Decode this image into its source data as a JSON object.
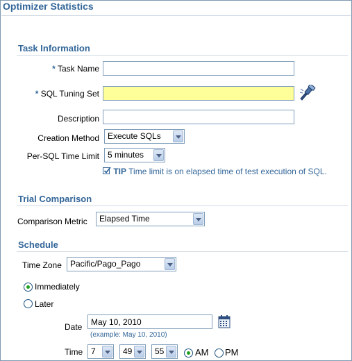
{
  "page": {
    "title": "Optimizer Statistics"
  },
  "task_information": {
    "header": "Task Information",
    "required_marker": "*",
    "task_name": {
      "label": "Task Name",
      "value": ""
    },
    "sql_tuning_set": {
      "label": "SQL Tuning Set",
      "value": "",
      "search_icon": "flashlight-search-icon"
    },
    "description": {
      "label": "Description",
      "value": ""
    },
    "creation_method": {
      "label": "Creation Method",
      "selected": "Execute SQLs"
    },
    "per_sql_time_limit": {
      "label": "Per-SQL Time Limit",
      "selected": "5 minutes"
    },
    "tip": {
      "prefix": "TIP",
      "text": "Time limit is on elapsed time of test execution of SQL."
    }
  },
  "trial_comparison": {
    "header": "Trial Comparison",
    "comparison_metric": {
      "label": "Comparison Metric",
      "selected": "Elapsed Time"
    }
  },
  "schedule": {
    "header": "Schedule",
    "time_zone": {
      "label": "Time Zone",
      "selected": "Pacific/Pago_Pago"
    },
    "immediately": {
      "label": "Immediately",
      "checked": true
    },
    "later": {
      "label": "Later",
      "checked": false
    },
    "date": {
      "label": "Date",
      "value": "May 10, 2010",
      "example": "(example: May 10, 2010)",
      "calendar_icon": "calendar-icon"
    },
    "time": {
      "label": "Time",
      "hour": "7",
      "minute": "49",
      "second": "55",
      "am_label": "AM",
      "pm_label": "PM",
      "meridiem": "AM"
    }
  },
  "colors": {
    "accent": "#336699",
    "required_field_bg": "#ffff99",
    "radio_checked": "#21a121"
  }
}
